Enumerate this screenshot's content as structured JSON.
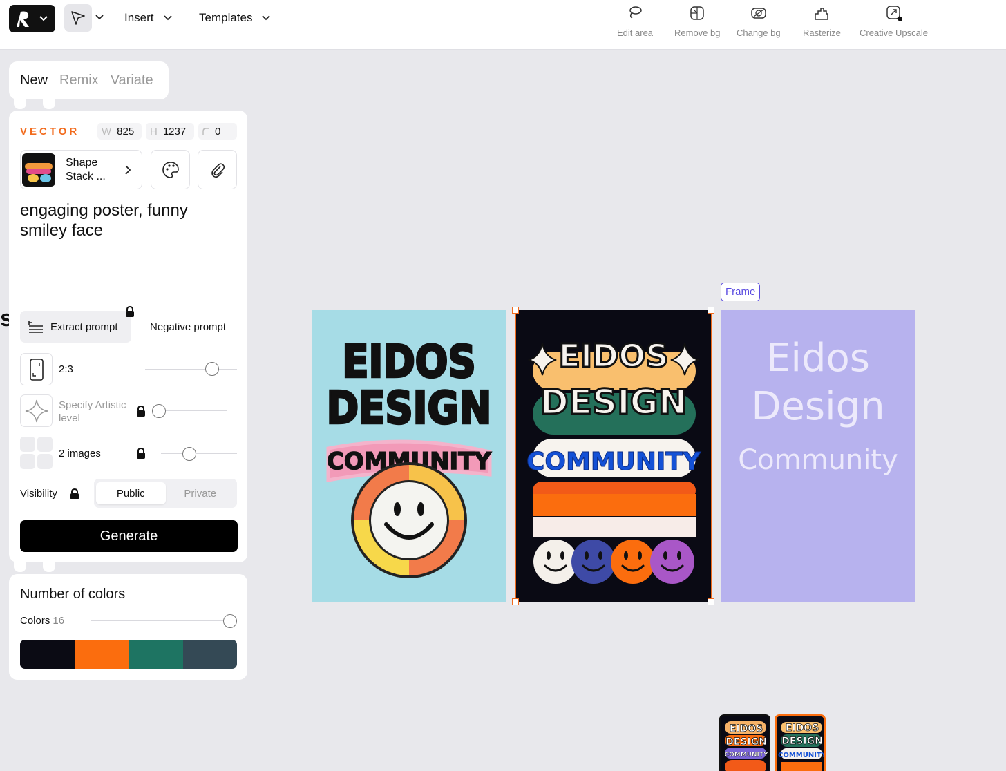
{
  "toolbar": {
    "menus": [
      "Insert",
      "Templates"
    ],
    "tools": [
      "Edit area",
      "Remove bg",
      "Change bg",
      "Rasterize",
      "Creative Upscale"
    ]
  },
  "tabs": [
    "New",
    "Remix",
    "Variate"
  ],
  "settings": {
    "type_label": "VECTOR",
    "width_key": "W",
    "width": "825",
    "height_key": "H",
    "height": "1237",
    "radius": "0",
    "style_name": "Shape Stack ...",
    "prompt": "engaging poster, funny smiley face",
    "extract_prompt": "Extract prompt",
    "negative_prompt": "Negative prompt",
    "aspect_ratio": "2:3",
    "artistic_level": "Specify Artistic level",
    "images": "2 images",
    "visibility_label": "Visibility",
    "visibility_options": [
      "Public",
      "Private"
    ],
    "visibility_selected": "Public",
    "generate": "Generate"
  },
  "colors": {
    "title": "Number of colors",
    "label": "Colors",
    "count": "16",
    "palette": [
      "#0b0b14",
      "#fb6d0e",
      "#1e7462",
      "#344955"
    ]
  },
  "canvas": {
    "frame_tag": "Frame",
    "poster1": {
      "line1": "EIDOS",
      "line2": "DESIGN",
      "line3": "COMMUNITY"
    },
    "poster2": {
      "line1": "EIDOS",
      "line2": "DESIGN",
      "line3": "COMMUNITY"
    },
    "poster3": {
      "line1": "Eidos",
      "line2": "Design",
      "line3": "Community"
    },
    "mini1": {
      "line1": "EIDOS",
      "line2": "DESIGN",
      "line3": "COMMUNITY"
    },
    "mini2": {
      "line1": "EIDOS",
      "line2": "DESIGN",
      "line3": "COMMUNITY"
    }
  }
}
